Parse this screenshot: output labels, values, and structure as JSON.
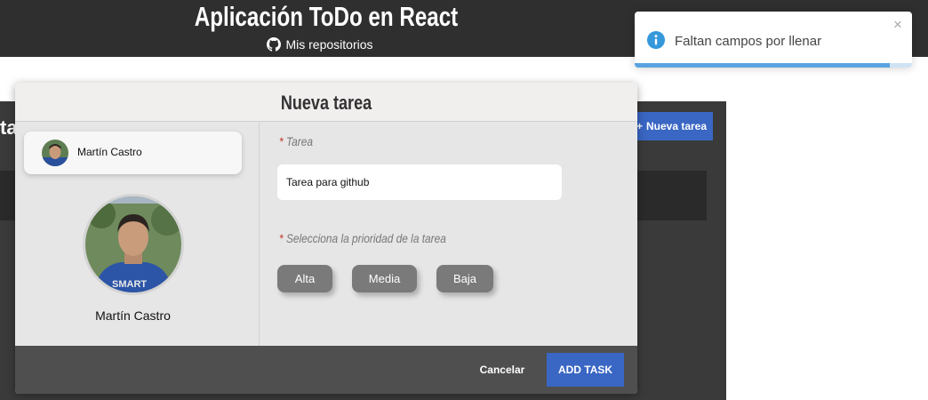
{
  "header": {
    "app_title": "Aplicación ToDo en React",
    "repo_link_label": "Mis repositorios"
  },
  "background": {
    "title_fragment": "ta",
    "new_task_label": "Nueva tarea"
  },
  "modal": {
    "title": "Nueva tarea",
    "user": {
      "name": "Martín Castro"
    },
    "task_field": {
      "required_mark": "*",
      "label": "Tarea",
      "value": "Tarea para github"
    },
    "priority_field": {
      "required_mark": "*",
      "label": "Selecciona la prioridad de la tarea",
      "options": [
        "Alta",
        "Media",
        "Baja"
      ]
    },
    "footer": {
      "cancel_label": "Cancelar",
      "add_label": "ADD TASK"
    }
  },
  "toast": {
    "type": "info",
    "message": "Faltan campos por llenar",
    "close_glyph": "×",
    "progress": 0.92
  },
  "colors": {
    "header_bg": "#2f2f2f",
    "accent_blue": "#3a66c4",
    "toast_info": "#3498db",
    "priority_button": "#7a7a7a",
    "modal_footer": "#4f4f4f"
  },
  "icons": {
    "repo_link": "github-icon",
    "toast": "info-circle-icon",
    "new_task": "plus-icon",
    "toast_close": "close-icon"
  }
}
